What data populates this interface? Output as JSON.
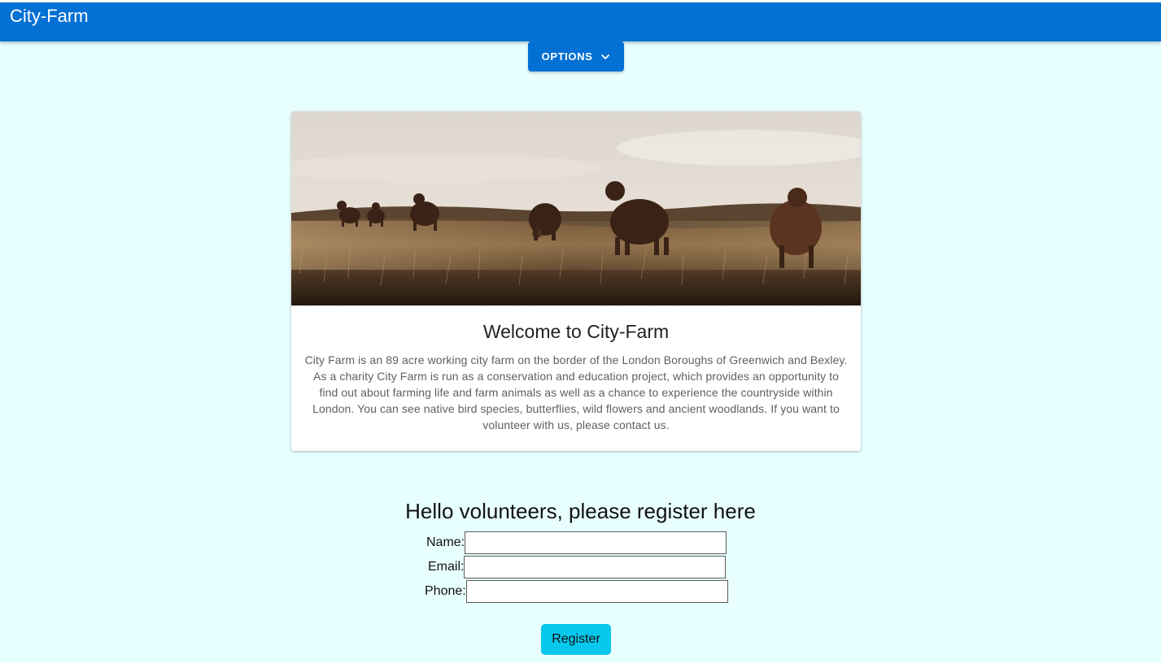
{
  "appbar": {
    "title": "City-Farm"
  },
  "options_menu": {
    "label": "OPTIONS",
    "icon": "chevron-down-icon"
  },
  "welcome_card": {
    "image_alt_subject": "cows in a grassy field",
    "title": "Welcome to City-Farm",
    "body": "City Farm is an 89 acre working city farm on the border of the London Boroughs of Greenwich and Bexley. As a charity City Farm is run as a conservation and education project, which provides an opportunity to find out about farming life and farm animals as well as a chance to experience the countryside within London. You can see native bird species, butterflies, wild flowers and ancient woodlands. If you want to volunteer with us, please contact us."
  },
  "volunteer_form": {
    "heading": "Hello volunteers, please register here",
    "name_label": "Name:",
    "email_label": "Email:",
    "phone_label": "Phone:",
    "name_value": "",
    "email_value": "",
    "phone_value": "",
    "submit_label": "Register"
  },
  "colors": {
    "appbar": "#0370d4",
    "page_background": "#e8ffff",
    "register_button": "#05c8ec"
  }
}
